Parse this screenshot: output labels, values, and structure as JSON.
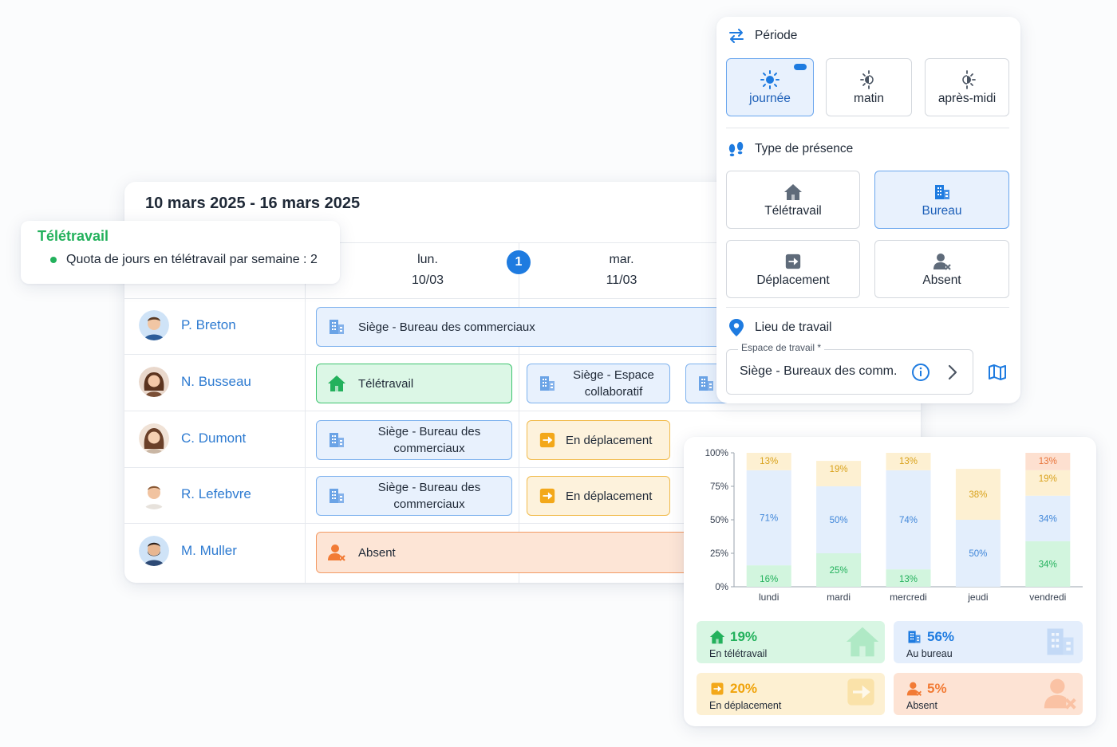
{
  "schedule": {
    "week_label": "10 mars 2025 - 16 mars 2025",
    "days": [
      {
        "name": "lun.",
        "date": "10/03"
      },
      {
        "name": "mar.",
        "date": "11/03"
      }
    ],
    "day_badge": "1",
    "people": [
      {
        "name": "P. Breton"
      },
      {
        "name": "N. Busseau"
      },
      {
        "name": "C. Dumont"
      },
      {
        "name": "R. Lefebvre"
      },
      {
        "name": "M. Muller"
      }
    ],
    "cells": {
      "breton_mon": "Siège - Bureau des commerciaux",
      "busseau_mon": "Télétravail",
      "busseau_tue": "Siège - Espace collaboratif",
      "dumont_mon": "Siège - Bureau des commerciaux",
      "dumont_tue": "En déplacement",
      "lefebvre_mon": "Siège - Bureau des commerciaux",
      "lefebvre_tue": "En déplacement",
      "muller_mon": "Absent"
    }
  },
  "tele_tip": {
    "title": "Télétravail",
    "quota": "Quota de jours en télétravail par semaine : 2"
  },
  "panel": {
    "periode_title": "Période",
    "periode_options": [
      "journée",
      "matin",
      "après-midi"
    ],
    "periode_selected": "journée",
    "presence_title": "Type de présence",
    "presence_options": [
      "Télétravail",
      "Bureau",
      "Déplacement",
      "Absent"
    ],
    "presence_selected": "Bureau",
    "lieu_title": "Lieu de travail",
    "workspace_label": "Espace de travail *",
    "workspace_value": "Siège - Bureaux des comm."
  },
  "colors": {
    "accent": "#1e7be0",
    "teletravail": "#23b15c",
    "bureau": "#1e7be0",
    "deplacement": "#f0a30a",
    "absent": "#f27b35"
  },
  "chart_data": {
    "type": "bar",
    "stacked": true,
    "categories": [
      "lundi",
      "mardi",
      "mercredi",
      "jeudi",
      "vendredi"
    ],
    "yticks": [
      "0%",
      "25%",
      "50%",
      "75%",
      "100%"
    ],
    "ylim": [
      0,
      100
    ],
    "series": [
      {
        "key": "teletravail",
        "values": [
          16,
          25,
          13,
          0,
          34
        ],
        "labels": [
          "16%",
          "25%",
          "13%",
          "",
          "34%"
        ],
        "color": "#d2f5de",
        "text": "#23b15c"
      },
      {
        "key": "bureau",
        "values": [
          71,
          50,
          74,
          50,
          34
        ],
        "labels": [
          "71%",
          "50%",
          "74%",
          "50%",
          "34%"
        ],
        "color": "#e3eefc",
        "text": "#3f86d9"
      },
      {
        "key": "deplacement",
        "values": [
          13,
          19,
          13,
          38,
          19
        ],
        "labels": [
          "13%",
          "19%",
          "13%",
          "38%",
          "19%"
        ],
        "color": "#fdf0d2",
        "text": "#d9a21c"
      },
      {
        "key": "absent",
        "values": [
          0,
          0,
          0,
          0,
          13
        ],
        "labels": [
          "",
          "",
          "",
          "",
          "13%"
        ],
        "color": "#fde0d0",
        "text": "#e8743a"
      }
    ]
  },
  "stats": [
    {
      "value": "19%",
      "label": "En télétravail"
    },
    {
      "value": "56%",
      "label": "Au bureau"
    },
    {
      "value": "20%",
      "label": "En déplacement"
    },
    {
      "value": "5%",
      "label": "Absent"
    }
  ]
}
